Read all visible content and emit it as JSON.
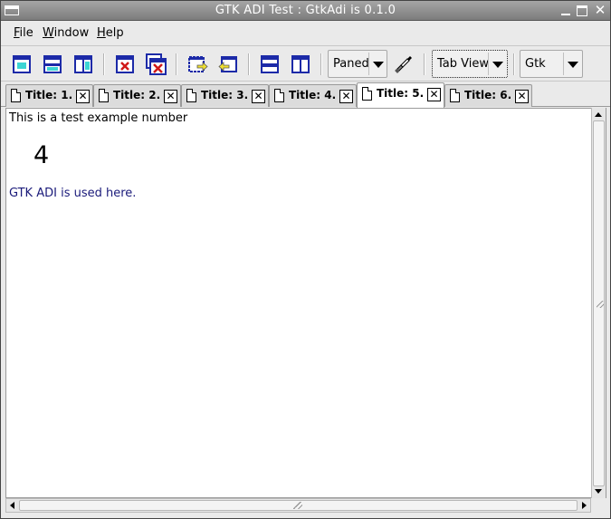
{
  "window": {
    "title": "GTK ADI Test : GtkAdi is 0.1.0"
  },
  "menubar": {
    "items": [
      {
        "label": "File",
        "mnemonic": "F",
        "rest": "ile"
      },
      {
        "label": "Window",
        "mnemonic": "W",
        "rest": "indow"
      },
      {
        "label": "Help",
        "mnemonic": "H",
        "rest": "elp"
      }
    ]
  },
  "toolbar": {
    "icons": [
      "new-window-icon",
      "new-horizontal-icon",
      "new-vertical-icon",
      "close-child-icon",
      "close-all-icon",
      "move-to-child-icon",
      "move-to-parent-icon",
      "tile-horizontal-icon",
      "tile-vertical-icon",
      "brush-icon"
    ],
    "combo_paned": "Paned",
    "combo_view": "Tab View",
    "combo_gtk": "Gtk"
  },
  "tabs": [
    {
      "label": "Title: 1.",
      "active": false
    },
    {
      "label": "Title: 2.",
      "active": false
    },
    {
      "label": "Title: 3.",
      "active": false
    },
    {
      "label": "Title: 4.",
      "active": false
    },
    {
      "label": "Title: 5.",
      "active": true
    },
    {
      "label": "Title: 6.",
      "active": false
    }
  ],
  "content": {
    "line1": "This is a test example number",
    "number": "4",
    "line2": "GTK ADI is used here."
  },
  "colors": {
    "accent_blue": "#1a1a7a",
    "icon_blue": "#1c2aa8",
    "icon_red": "#d01818"
  }
}
